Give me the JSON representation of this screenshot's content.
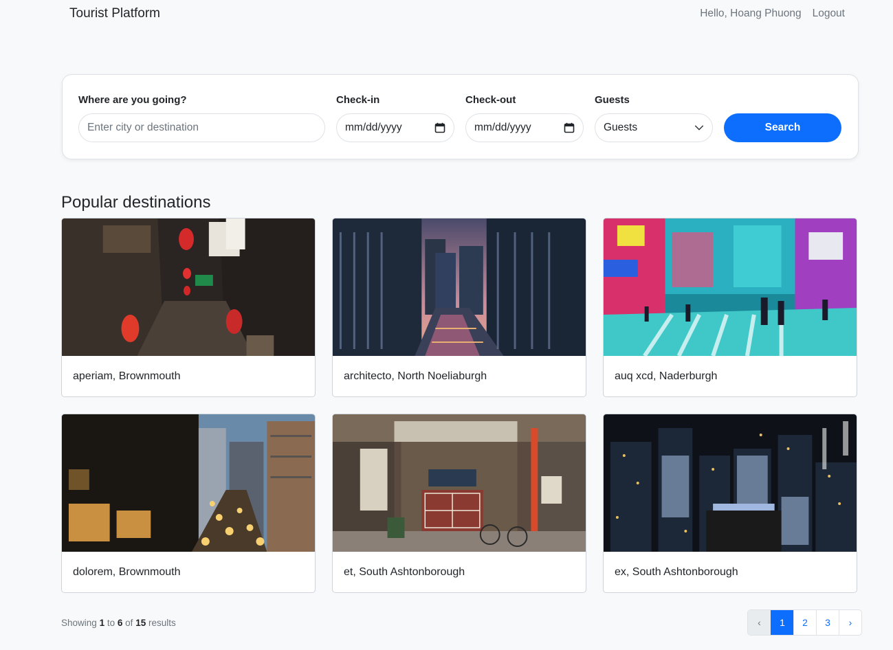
{
  "navbar": {
    "brand": "Tourist Platform",
    "greeting": "Hello, Hoang Phuong",
    "logout": "Logout"
  },
  "search": {
    "destination_label": "Where are you going?",
    "destination_placeholder": "Enter city or destination",
    "checkin_label": "Check-in",
    "checkin_value": "mm/dd/yyyy",
    "checkout_label": "Check-out",
    "checkout_value": "mm/dd/yyyy",
    "guests_label": "Guests",
    "guests_value": "Guests",
    "button": "Search"
  },
  "section_title": "Popular destinations",
  "destinations": [
    {
      "name": "aperiam, Brownmouth"
    },
    {
      "name": "architecto, North Noeliaburgh"
    },
    {
      "name": "auq xcd, Naderburgh"
    },
    {
      "name": "dolorem, Brownmouth"
    },
    {
      "name": "et, South Ashtonborough"
    },
    {
      "name": "ex, South Ashtonborough"
    }
  ],
  "results": {
    "prefix": "Showing",
    "from": "1",
    "to_word": "to",
    "to": "6",
    "of_word": "of",
    "total": "15",
    "suffix": "results"
  },
  "pagination": {
    "prev": "‹",
    "pages": [
      "1",
      "2",
      "3"
    ],
    "active": "1",
    "next": "›"
  },
  "colors": {
    "primary": "#0d6efd",
    "background": "#f8f9fa"
  }
}
